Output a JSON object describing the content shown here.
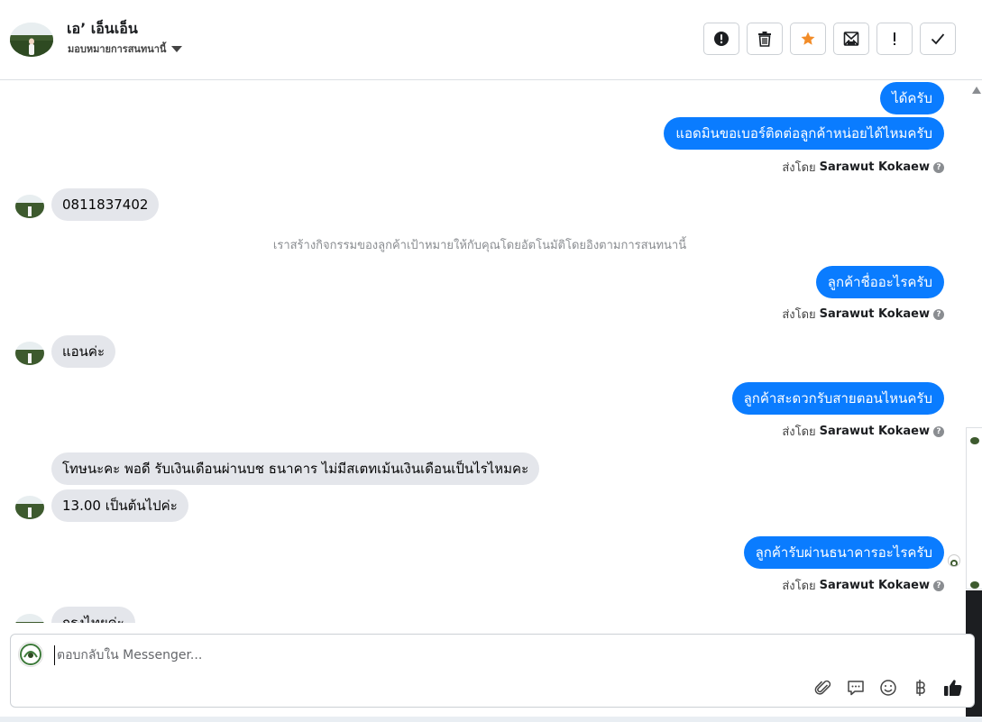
{
  "header": {
    "contact_name": "เอ’ เอ็นเอ็น",
    "assign_label": "มอบหมายการสนทนานี้"
  },
  "messages": [
    {
      "id": 1,
      "direction": "out",
      "text": "ได้ครับ"
    },
    {
      "id": 2,
      "direction": "out",
      "text": "แอดมินขอเบอร์ติดต่อลูกค้าหน่อยได้ไหมครับ",
      "sent_by_prefix": "ส่งโดย",
      "sent_by_name": "Sarawut Kokaew"
    },
    {
      "id": 3,
      "direction": "in",
      "text": "0811837402"
    },
    {
      "id": 4,
      "direction": "system",
      "text": "เราสร้างกิจกรรมของลูกค้าเป้าหมายให้กับคุณโดยอัตโนมัติโดยอิงตามการสนทนานี้"
    },
    {
      "id": 5,
      "direction": "out",
      "text": "ลูกค้าชื่ออะไรครับ",
      "sent_by_prefix": "ส่งโดย",
      "sent_by_name": "Sarawut Kokaew"
    },
    {
      "id": 6,
      "direction": "in",
      "text": "แอนค่ะ"
    },
    {
      "id": 7,
      "direction": "out",
      "text": "ลูกค้าสะดวกรับสายตอนไหนครับ",
      "sent_by_prefix": "ส่งโดย",
      "sent_by_name": "Sarawut Kokaew"
    },
    {
      "id": 8,
      "direction": "in",
      "text": "โทษนะคะ  พอดี รับเงินเดือนผ่านบช ธนาคาร ไม่มีสเตทเม้นเงินเดือนเป็นไรไหมคะ"
    },
    {
      "id": 9,
      "direction": "in",
      "text": "13.00 เป็นต้นไปค่ะ"
    },
    {
      "id": 10,
      "direction": "out",
      "text": "ลูกค้ารับผ่านธนาคารอะไรครับ",
      "sent_by_prefix": "ส่งโดย",
      "sent_by_name": "Sarawut Kokaew"
    },
    {
      "id": 11,
      "direction": "in",
      "text": "กรุงไทยค่ะ"
    }
  ],
  "composer": {
    "placeholder": "ตอบกลับใน Messenger..."
  },
  "icons": {
    "actions": [
      "report-icon",
      "trash-icon",
      "star-icon",
      "mark-unread-icon",
      "exclamation-icon",
      "check-icon"
    ],
    "tools": [
      "attachment-icon",
      "saved-replies-icon",
      "emoji-icon",
      "baht-payment-icon",
      "thumbs-up-icon"
    ]
  },
  "colors": {
    "outgoing_bubble": "#0a7cff",
    "incoming_bubble": "#e4e6eb",
    "star": "#f28c28"
  }
}
